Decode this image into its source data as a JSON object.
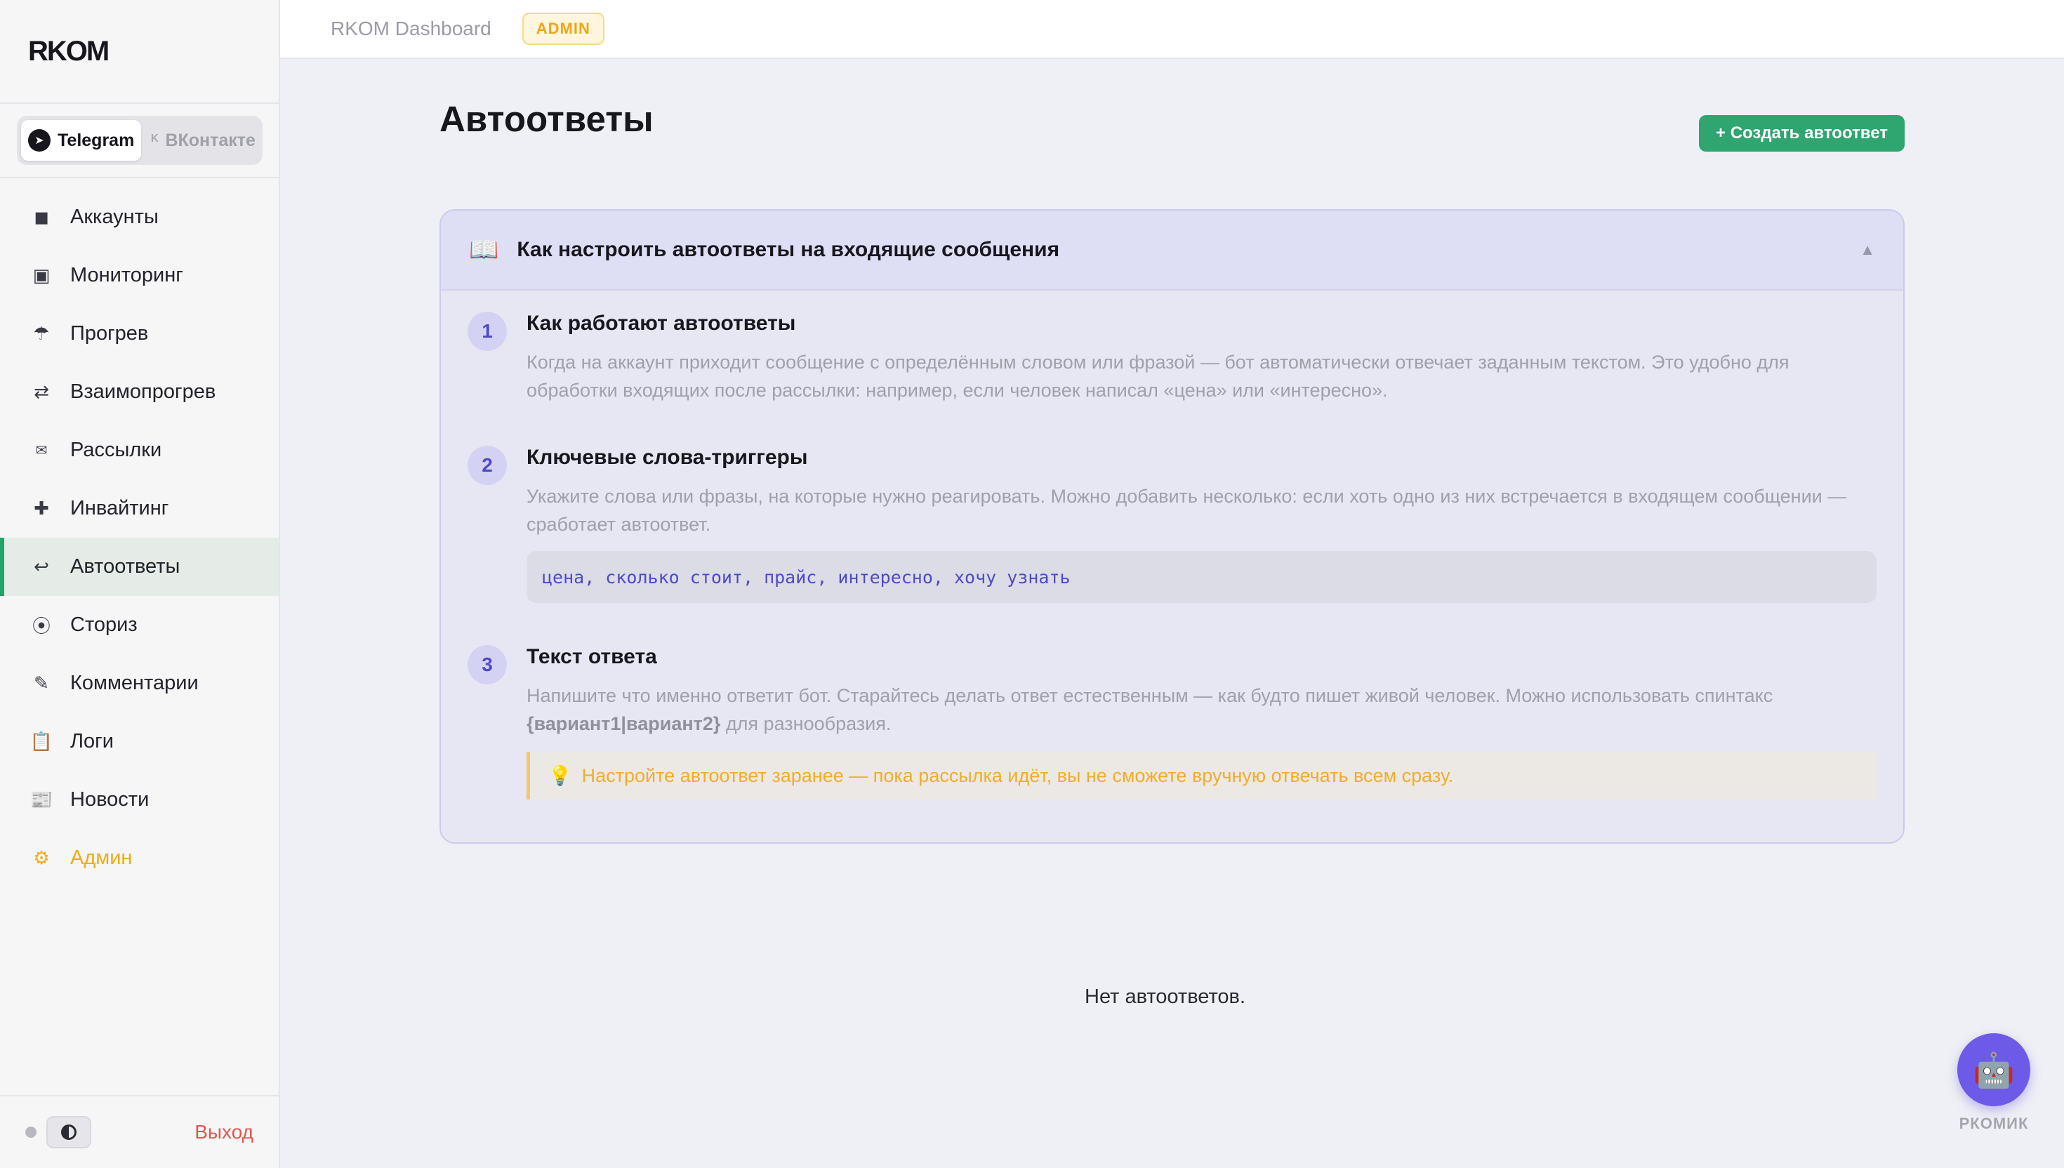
{
  "sidebar": {
    "logo": "RKOM",
    "platforms": [
      {
        "label": "Telegram",
        "active": true
      },
      {
        "label": "ВКонтакте",
        "active": false
      }
    ],
    "items": [
      {
        "label": "Аккаунты",
        "icon": "square-icon",
        "glyph": "◼"
      },
      {
        "label": "Мониторинг",
        "icon": "monitor-icon",
        "glyph": "▣"
      },
      {
        "label": "Прогрев",
        "icon": "umbrella-icon",
        "glyph": "☂"
      },
      {
        "label": "Взаимопрогрев",
        "icon": "swap-icon",
        "glyph": "⇄"
      },
      {
        "label": "Рассылки",
        "icon": "mail-icon",
        "glyph": "✉"
      },
      {
        "label": "Инвайтинг",
        "icon": "plus-icon",
        "glyph": "✚"
      },
      {
        "label": "Автоответы",
        "icon": "reply-icon",
        "glyph": "↩"
      },
      {
        "label": "Сториз",
        "icon": "circle-dot-icon",
        "glyph": "⦿"
      },
      {
        "label": "Комментарии",
        "icon": "pencil-icon",
        "glyph": "✎"
      },
      {
        "label": "Логи",
        "icon": "clipboard-icon",
        "glyph": "📋"
      },
      {
        "label": "Новости",
        "icon": "newspaper-icon",
        "glyph": "📰"
      },
      {
        "label": "Админ",
        "icon": "gear-icon",
        "glyph": "⚙"
      }
    ],
    "logout": "Выход"
  },
  "topbar": {
    "title": "RKOM Dashboard",
    "badge": "ADMIN"
  },
  "page": {
    "title": "Автоответы",
    "create_button": "+ Создать автоответ",
    "empty": "Нет автоответов."
  },
  "guide": {
    "title": "Как настроить автоответы на входящие сообщения",
    "steps": [
      {
        "num": "1",
        "title": "Как работают автоответы",
        "text": "Когда на аккаунт приходит сообщение с определённым словом или фразой — бот автоматически отвечает заданным текстом. Это удобно для обработки входящих после рассылки: например, если человек написал «цена» или «интересно»."
      },
      {
        "num": "2",
        "title": "Ключевые слова-триггеры",
        "text": "Укажите слова или фразы, на которые нужно реагировать. Можно добавить несколько: если хоть одно из них встречается в входящем сообщении — сработает автоответ.",
        "code": "цена, сколько стоит, прайс, интересно, хочу узнать"
      },
      {
        "num": "3",
        "title": "Текст ответа",
        "text_before": "Напишите что именно ответит бот. Старайтесь делать ответ естественным — как будто пишет живой человек. Можно использовать спинтакс",
        "spintax": "{вариант1|вариант2}",
        "text_after": "для разнообразия.",
        "tip": "Настройте автоответ заранее — пока рассылка идёт, вы не сможете вручную отвечать всем сразу."
      }
    ]
  },
  "assistant": {
    "label": "РКОМИК"
  },
  "colors": {
    "accent": "#2fa56f",
    "admin": "#f0ac12",
    "logout": "#e0574f",
    "step_num": "#4e4ac4"
  }
}
